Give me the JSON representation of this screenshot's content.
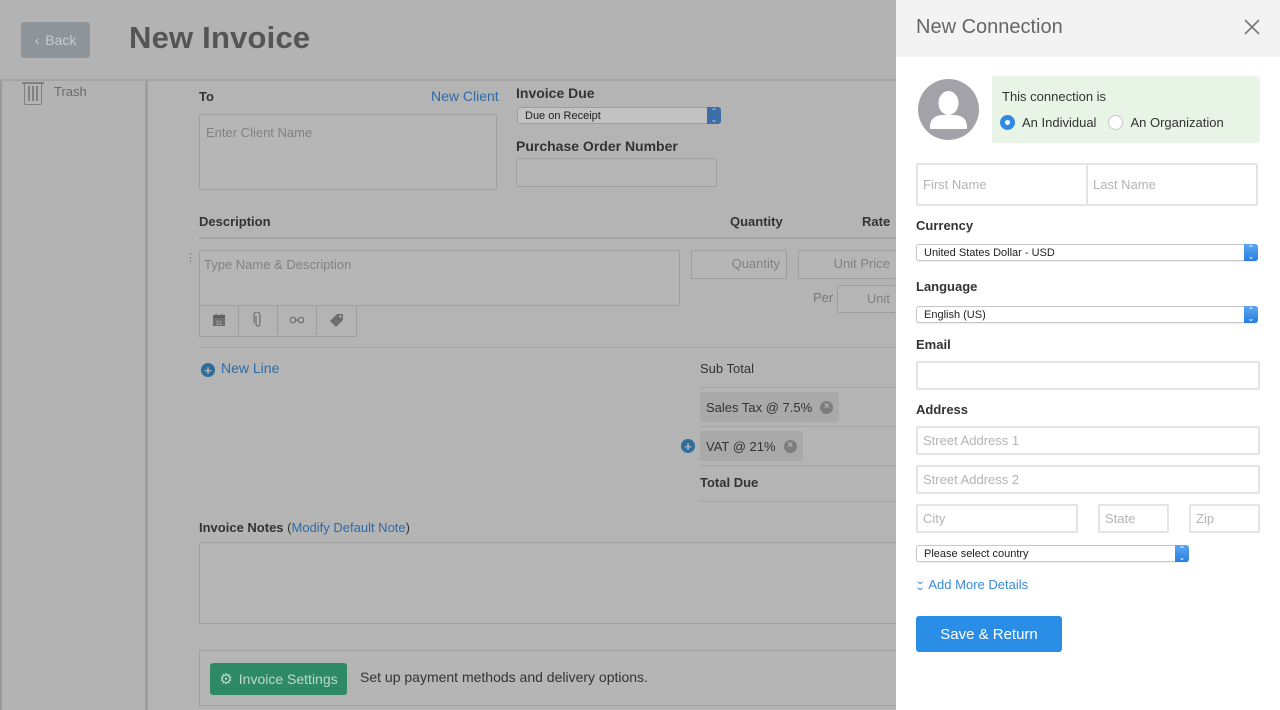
{
  "header": {
    "back_label": "Back",
    "title": "New Invoice"
  },
  "sidebar": {
    "items": [
      {
        "label": "Trash",
        "icon": "trash-icon"
      }
    ]
  },
  "invoice": {
    "to_label": "To",
    "new_client_link": "New Client",
    "client_placeholder": "Enter Client Name",
    "invoice_due_label": "Invoice Due",
    "invoice_due_value": "Due on Receipt",
    "po_label": "Purchase Order Number",
    "po_value": "",
    "columns": {
      "description": "Description",
      "quantity": "Quantity",
      "rate": "Rate"
    },
    "line": {
      "description_placeholder": "Type Name & Description",
      "quantity_placeholder": "Quantity",
      "unit_price_placeholder": "Unit Price",
      "per_label": "Per",
      "unit_placeholder": "Unit",
      "tools": [
        "calendar-icon",
        "paperclip-icon",
        "link-icon",
        "tag-icon"
      ],
      "calendar_day": "31"
    },
    "new_line_label": "New Line",
    "totals": {
      "sub_total": "Sub Total",
      "taxes": [
        "Sales Tax @ 7.5%",
        "VAT @ 21%"
      ],
      "total_due": "Total Due"
    },
    "notes_label": "Invoice Notes",
    "notes_link": "Modify Default Note",
    "settings_button": "Invoice Settings",
    "settings_text": "Set up payment methods and delivery options."
  },
  "drawer": {
    "title": "New Connection",
    "type_prompt": "This connection is",
    "type_options": [
      {
        "label": "An Individual",
        "selected": true
      },
      {
        "label": "An Organization",
        "selected": false
      }
    ],
    "first_name_placeholder": "First Name",
    "last_name_placeholder": "Last Name",
    "currency_label": "Currency",
    "currency_value": "United States Dollar - USD",
    "language_label": "Language",
    "language_value": "English (US)",
    "email_label": "Email",
    "email_value": "",
    "address_label": "Address",
    "street1_placeholder": "Street Address 1",
    "street2_placeholder": "Street Address 2",
    "city_placeholder": "City",
    "state_placeholder": "State",
    "zip_placeholder": "Zip",
    "country_value": "Please select country",
    "add_more_label": "Add More Details",
    "save_label": "Save & Return"
  },
  "colors": {
    "primary_blue": "#2a8ee6",
    "settings_green": "#2e8a66",
    "type_box_green": "#e8f4e6",
    "overlay_gray": "#b4b4b4"
  }
}
